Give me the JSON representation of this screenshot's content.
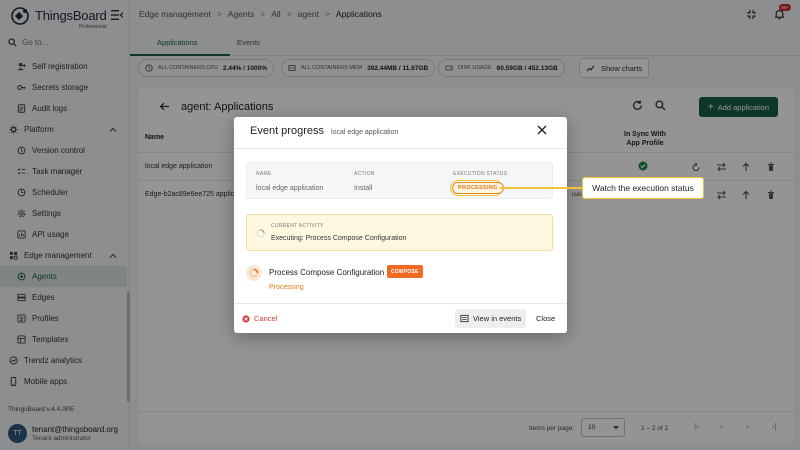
{
  "app": {
    "logo_name": "ThingsBoard",
    "logo_sub": "Professional",
    "goto_placeholder": "Go to...",
    "version": "ThingsBoard v.4.4.0PE"
  },
  "sidebar": {
    "items": [
      {
        "label": "Self registration",
        "icon": "person-add-icon",
        "type": "child"
      },
      {
        "label": "Secrets storage",
        "icon": "key-icon",
        "type": "child"
      },
      {
        "label": "Audit logs",
        "icon": "audit-icon",
        "type": "child"
      },
      {
        "label": "Platform",
        "icon": "gear-icon",
        "type": "section"
      },
      {
        "label": "Version control",
        "icon": "history-icon",
        "type": "child"
      },
      {
        "label": "Task manager",
        "icon": "task-icon",
        "type": "child"
      },
      {
        "label": "Scheduler",
        "icon": "clock-icon",
        "type": "child"
      },
      {
        "label": "Settings",
        "icon": "settings-icon",
        "type": "child"
      },
      {
        "label": "API usage",
        "icon": "chart-icon",
        "type": "child"
      },
      {
        "label": "Edge management",
        "icon": "edge-icon",
        "type": "section"
      },
      {
        "label": "Agents",
        "icon": "agents-icon",
        "type": "child",
        "active": true
      },
      {
        "label": "Edges",
        "icon": "edges-icon",
        "type": "child"
      },
      {
        "label": "Profiles",
        "icon": "profiles-icon",
        "type": "child"
      },
      {
        "label": "Templates",
        "icon": "templates-icon",
        "type": "child"
      },
      {
        "label": "Trendz analytics",
        "icon": "trendz-icon",
        "type": "section-flat"
      },
      {
        "label": "Mobile apps",
        "icon": "phone-icon",
        "type": "section-flat"
      }
    ]
  },
  "user": {
    "initials": "TT",
    "email": "tenant@thingsboard.org",
    "role": "Tenant administrator"
  },
  "header": {
    "breadcrumbs": [
      "Edge management",
      "Agents",
      "All",
      "agent",
      "Applications"
    ],
    "notification_count": "99+"
  },
  "tabs": [
    "Applications",
    "Events"
  ],
  "stats": {
    "cpu_label": "ALL CONTAINERS CPU",
    "cpu_value": "2.44% / 1000%",
    "mem_label": "ALL CONTAINERS MEM",
    "mem_value": "392.44MB / 11.67GB",
    "disk_label": "DISK USAGE",
    "disk_value": "60.59GB / 452.13GB",
    "show_charts": "Show charts"
  },
  "card": {
    "title": "agent: Applications",
    "add_button": "Add application",
    "col_name": "Name",
    "col_sync": "In Sync With App Profile",
    "rows": [
      {
        "name": "local edge application"
      },
      {
        "name": "Edge-b2ac89e6ee725 applica",
        "extra": "isio"
      }
    ],
    "items_per_page_label": "Items per page:",
    "items_per_page": "10",
    "range": "1 – 2 of 2"
  },
  "dialog": {
    "title": "Event progress",
    "subtitle": "local edge application",
    "col_name": "NAME",
    "col_action": "ACTION",
    "col_status": "EXECUTION STATUS",
    "name_value": "local edge application",
    "action_value": "Install",
    "status_value": "PROCESSING",
    "activity_label": "CURRENT ACTIVITY",
    "activity_value": "Executing: Process Compose Configuration",
    "step_name": "Process Compose Configuration",
    "step_tag": "COMPOSE",
    "step_status": "Processing",
    "cancel": "Cancel",
    "view_events": "View in events",
    "close": "Close"
  },
  "callout": {
    "text": "Watch the execution status"
  },
  "colors": {
    "primary": "#1a5e49",
    "processing": "#e07b14",
    "highlight": "#f2c23b",
    "danger": "#d23c3c"
  }
}
